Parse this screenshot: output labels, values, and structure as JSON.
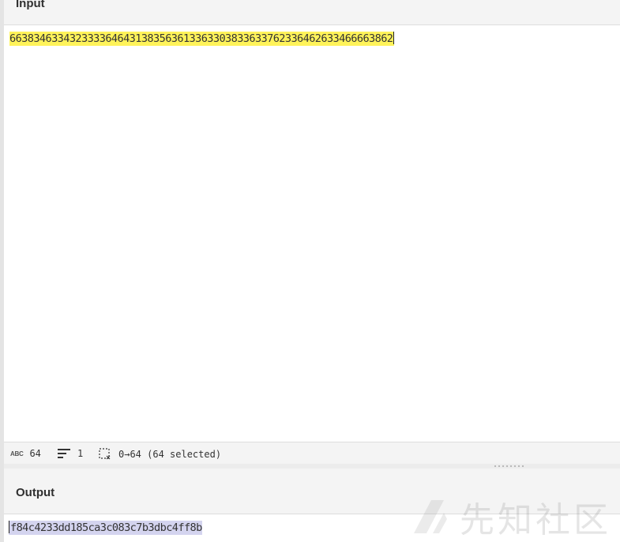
{
  "input": {
    "title": "Input",
    "text": "6638346334323333646431383563613363303833633762336462633466663862"
  },
  "status": {
    "length_icon": "ABC",
    "length": "64",
    "lines": "1",
    "selection": "0→64 (64 selected)"
  },
  "output": {
    "title": "Output",
    "text": "f84c4233dd185ca3c083c7b3dbc4ff8b"
  },
  "watermark": {
    "text": "先知社区"
  },
  "colors": {
    "input_highlight": "#fff35a",
    "output_highlight": "#d4d4ef",
    "header_bg": "#f4f4f4"
  }
}
